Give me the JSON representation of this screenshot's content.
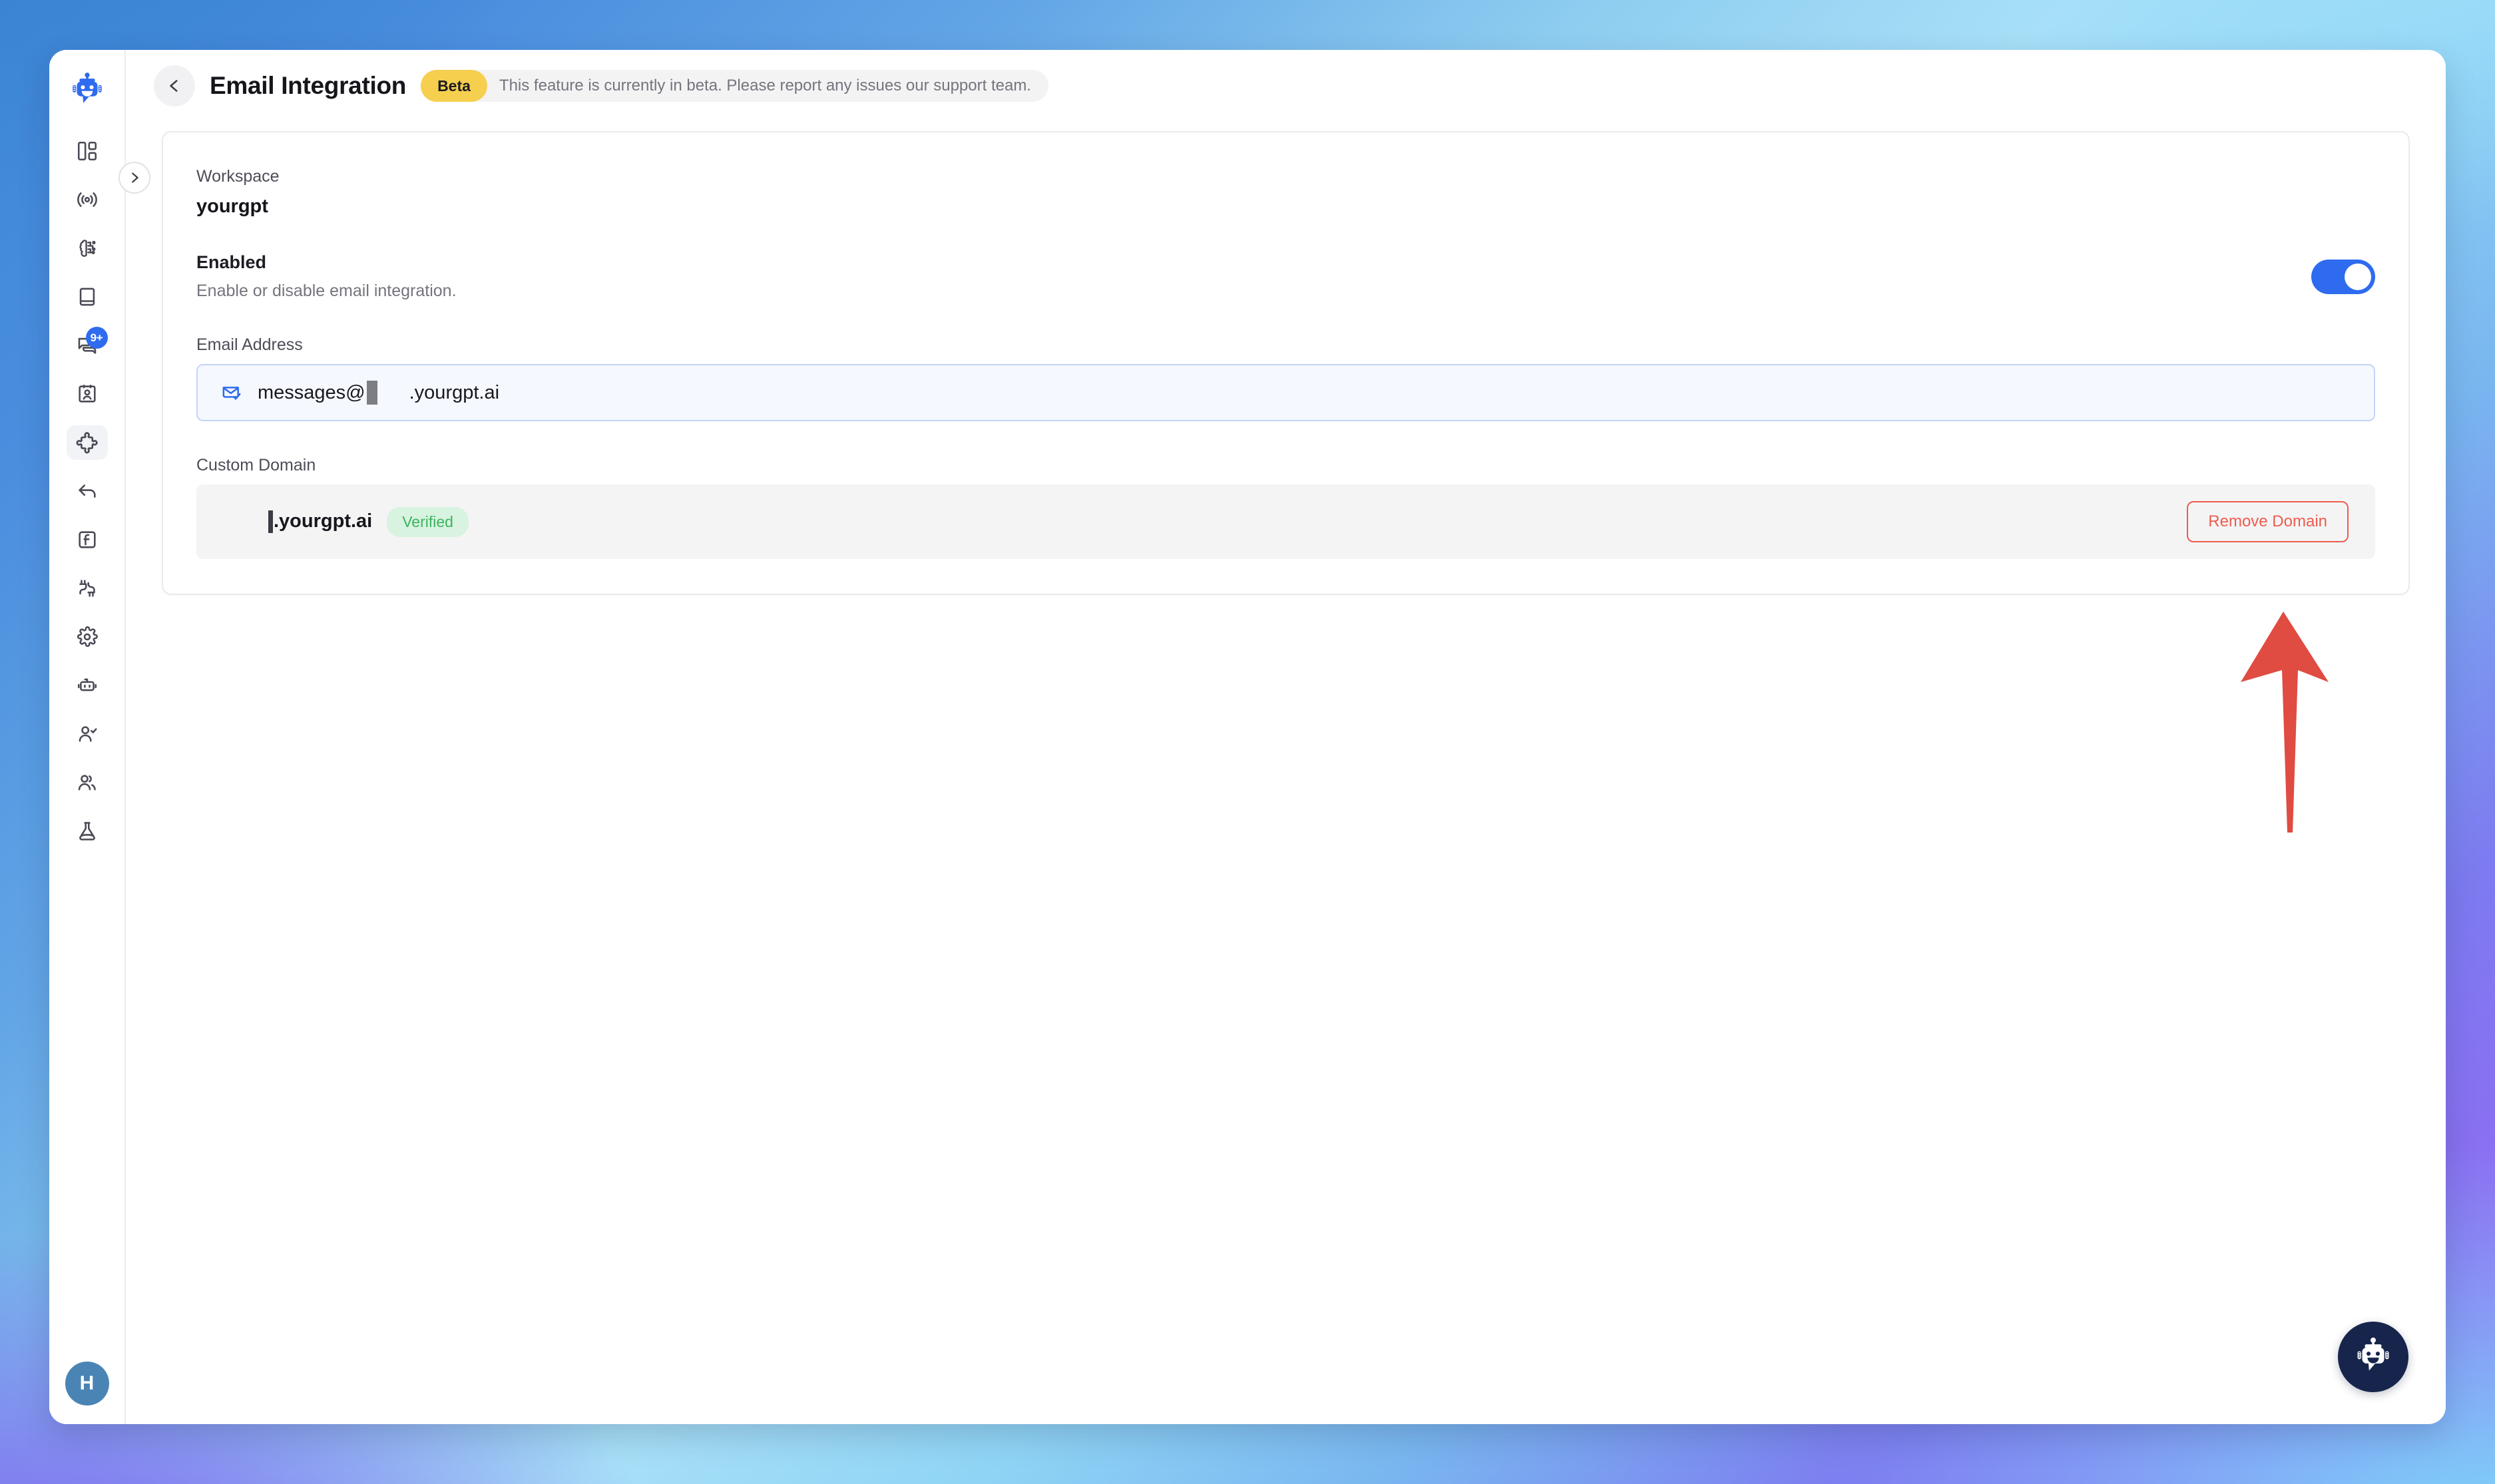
{
  "app": {
    "brand_icon": "robot-logo-icon",
    "expand_icon": "chevron-right-icon"
  },
  "sidebar": {
    "items": [
      {
        "name": "dashboard",
        "icon": "layout-dashboard-icon",
        "active": false,
        "badge": ""
      },
      {
        "name": "broadcast",
        "icon": "broadcast-signal-icon",
        "active": false,
        "badge": ""
      },
      {
        "name": "ai-brain",
        "icon": "brain-circuit-icon",
        "active": false,
        "badge": ""
      },
      {
        "name": "knowledge",
        "icon": "book-icon",
        "active": false,
        "badge": ""
      },
      {
        "name": "conversations",
        "icon": "chat-bubbles-icon",
        "active": false,
        "badge": "9+"
      },
      {
        "name": "contacts",
        "icon": "contact-card-icon",
        "active": false,
        "badge": ""
      },
      {
        "name": "integrations",
        "icon": "puzzle-piece-icon",
        "active": true,
        "badge": ""
      },
      {
        "name": "replies",
        "icon": "reply-arrow-icon",
        "active": false,
        "badge": ""
      },
      {
        "name": "functions",
        "icon": "function-box-icon",
        "active": false,
        "badge": ""
      },
      {
        "name": "connections",
        "icon": "plug-connector-icon",
        "active": false,
        "badge": ""
      },
      {
        "name": "settings",
        "icon": "gear-icon",
        "active": false,
        "badge": ""
      },
      {
        "name": "bots",
        "icon": "robot-icon",
        "active": false,
        "badge": ""
      },
      {
        "name": "agents",
        "icon": "user-check-icon",
        "active": false,
        "badge": ""
      },
      {
        "name": "teams",
        "icon": "users-group-icon",
        "active": false,
        "badge": ""
      },
      {
        "name": "labs",
        "icon": "flask-icon",
        "active": false,
        "badge": ""
      }
    ],
    "avatar_initial": "H"
  },
  "topbar": {
    "back_icon": "chevron-left-icon",
    "title": "Email Integration",
    "beta_pill": "Beta",
    "beta_message": "This feature is currently in beta. Please report any issues our support team."
  },
  "card": {
    "workspace": {
      "label": "Workspace",
      "value": "yourgpt"
    },
    "enabled": {
      "title": "Enabled",
      "description": "Enable or disable email integration.",
      "toggle_state": "on"
    },
    "email_address": {
      "label": "Email Address",
      "icon": "mail-check-icon",
      "prefix": "messages@",
      "suffix": ".yourgpt.ai"
    },
    "custom_domain": {
      "label": "Custom Domain",
      "domain_suffix": ".yourgpt.ai",
      "status_badge": "Verified",
      "remove_button": "Remove Domain"
    }
  },
  "annotation": {
    "arrow": "red-up-arrow",
    "color": "#e04b42"
  },
  "chat_widget": {
    "icon": "robot-chat-icon",
    "color": "#17254c"
  },
  "colors": {
    "accent_blue": "#2f6bef",
    "beta_yellow": "#f6cf4f",
    "verified_green": "#3cb45f",
    "danger_red": "#ef5b4c"
  }
}
